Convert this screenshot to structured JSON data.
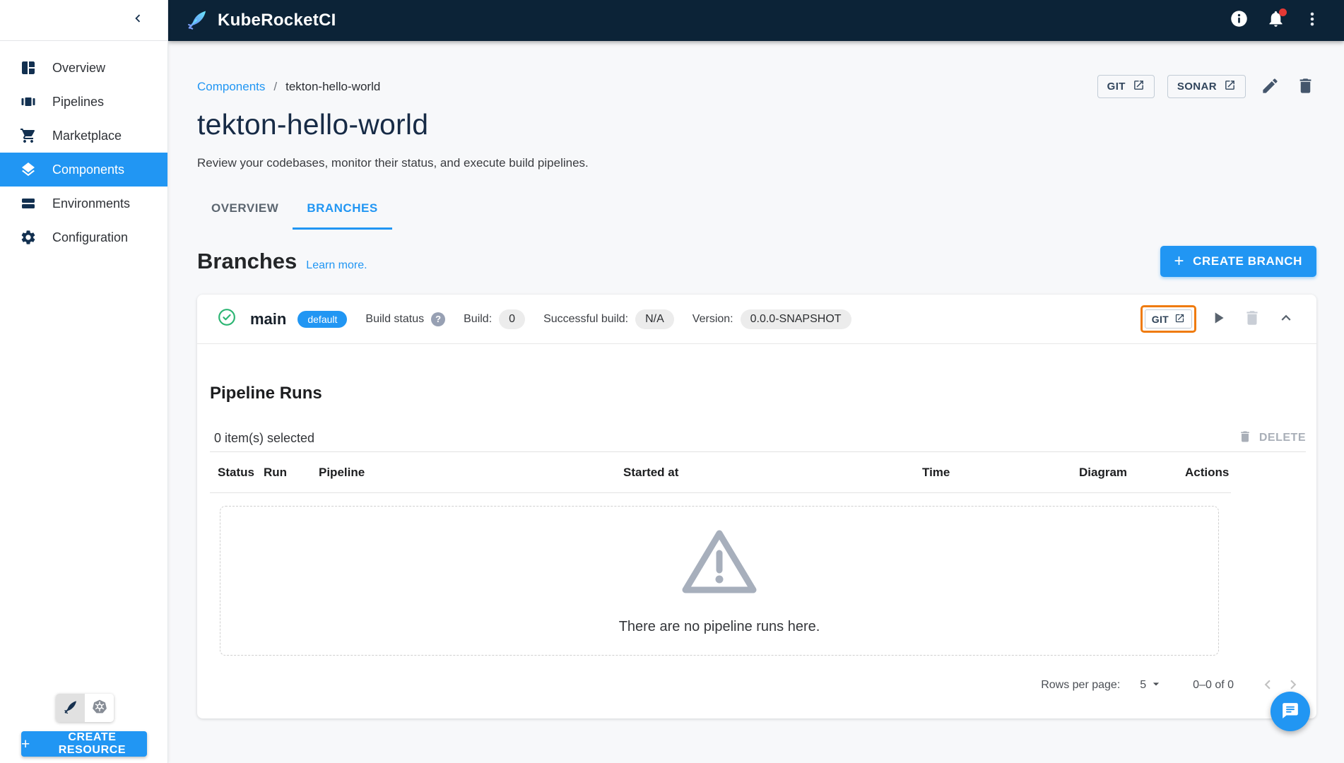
{
  "colors": {
    "accent": "#2196F3",
    "topbar_bg": "#0C2337",
    "highlight_orange": "#EF7B0E",
    "success_green": "#2CB573",
    "notification_red": "#E53935"
  },
  "topbar": {
    "app_name": "KubeRocketCI"
  },
  "sidebar": {
    "items": [
      {
        "label": "Overview"
      },
      {
        "label": "Pipelines"
      },
      {
        "label": "Marketplace"
      },
      {
        "label": "Components"
      },
      {
        "label": "Environments"
      },
      {
        "label": "Configuration"
      }
    ],
    "selected_item": "Components",
    "create_resource_label": "CREATE RESOURCE"
  },
  "header": {
    "breadcrumb": {
      "link": "Components",
      "separator": "/",
      "current": "tekton-hello-world"
    },
    "actions": {
      "git_label": "GIT",
      "sonar_label": "SONAR"
    }
  },
  "page": {
    "title": "tekton-hello-world",
    "subtitle": "Review your codebases, monitor their status, and execute build pipelines.",
    "tabs": [
      "OVERVIEW",
      "BRANCHES"
    ],
    "active_tab": "BRANCHES"
  },
  "branches_section": {
    "heading": "Branches",
    "learn_more_label": "Learn more.",
    "create_branch_label": "CREATE BRANCH"
  },
  "branch_row": {
    "name": "main",
    "default_chip": "default",
    "build_status_label": "Build status",
    "help_glyph": "?",
    "build_label": "Build:",
    "build_value": "0",
    "successful_build_label": "Successful build:",
    "successful_build_value": "N/A",
    "version_label": "Version:",
    "version_value": "0.0.0-SNAPSHOT",
    "git_button_label": "GIT"
  },
  "pipeline_runs": {
    "heading": "Pipeline Runs",
    "selected_count_text": "0 item(s) selected",
    "delete_label": "DELETE",
    "columns": [
      "Status",
      "Run",
      "Pipeline",
      "Started at",
      "Time",
      "Diagram",
      "Actions"
    ],
    "empty_message": "There are no pipeline runs here.",
    "pagination": {
      "rows_per_page_label": "Rows per page:",
      "rows_per_page_value": "5",
      "range_text": "0–0 of 0"
    }
  }
}
